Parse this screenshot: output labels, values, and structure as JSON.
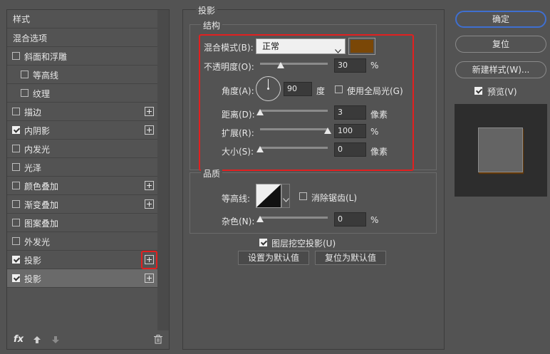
{
  "styles_list": {
    "header": "样式",
    "items": [
      {
        "label": "混合选项",
        "checkbox": false,
        "checked": false,
        "plus": false,
        "indent": 0
      },
      {
        "label": "斜面和浮雕",
        "checkbox": true,
        "checked": false,
        "plus": false,
        "indent": 0
      },
      {
        "label": "等高线",
        "checkbox": true,
        "checked": false,
        "plus": false,
        "indent": 1
      },
      {
        "label": "纹理",
        "checkbox": true,
        "checked": false,
        "plus": false,
        "indent": 1
      },
      {
        "label": "描边",
        "checkbox": true,
        "checked": false,
        "plus": true,
        "indent": 0
      },
      {
        "label": "内阴影",
        "checkbox": true,
        "checked": true,
        "plus": true,
        "indent": 0
      },
      {
        "label": "内发光",
        "checkbox": true,
        "checked": false,
        "plus": false,
        "indent": 0
      },
      {
        "label": "光泽",
        "checkbox": true,
        "checked": false,
        "plus": false,
        "indent": 0
      },
      {
        "label": "颜色叠加",
        "checkbox": true,
        "checked": false,
        "plus": true,
        "indent": 0
      },
      {
        "label": "渐变叠加",
        "checkbox": true,
        "checked": false,
        "plus": true,
        "indent": 0
      },
      {
        "label": "图案叠加",
        "checkbox": true,
        "checked": false,
        "plus": false,
        "indent": 0
      },
      {
        "label": "外发光",
        "checkbox": true,
        "checked": false,
        "plus": false,
        "indent": 0
      },
      {
        "label": "投影",
        "checkbox": true,
        "checked": true,
        "plus": true,
        "indent": 0
      },
      {
        "label": "投影",
        "checkbox": true,
        "checked": true,
        "plus": true,
        "indent": 0
      }
    ],
    "selected_index": 13,
    "highlighted_plus_index": 12,
    "bottom_icons": [
      "fx-icon",
      "move-up-icon",
      "move-down-icon",
      "trash-icon"
    ],
    "fx_label": "fx"
  },
  "buttons": {
    "ok": "确定",
    "reset": "复位",
    "new_style": "新建样式(W)...",
    "preview_label": "预览(V)",
    "preview_checked": true
  },
  "drop_shadow": {
    "title": "投影",
    "structure": {
      "title": "结构",
      "blend_mode_label": "混合模式(B):",
      "blend_mode_value": "正常",
      "shadow_color": "#7a4707",
      "opacity_label": "不透明度(O):",
      "opacity_value": "30",
      "opacity_unit": "%",
      "opacity_level": 0.3,
      "angle_label": "角度(A):",
      "angle_value": "90",
      "angle_unit": "度",
      "global_light_label": "使用全局光(G)",
      "global_light_checked": false,
      "distance_label": "距离(D):",
      "distance_value": "3",
      "distance_unit": "像素",
      "distance_level": 0.0,
      "spread_label": "扩展(R):",
      "spread_value": "100",
      "spread_unit": "%",
      "spread_level": 1.0,
      "size_label": "大小(S):",
      "size_value": "0",
      "size_unit": "像素",
      "size_level": 0.0
    },
    "quality": {
      "title": "品质",
      "contour_label": "等高线:",
      "antialias_label": "消除锯齿(L)",
      "antialias_checked": false,
      "noise_label": "杂色(N):",
      "noise_value": "0",
      "noise_unit": "%",
      "noise_level": 0.0
    },
    "knockout_label": "图层挖空投影(U)",
    "knockout_checked": true,
    "make_default": "设置为默认值",
    "reset_default": "复位为默认值"
  },
  "colors": {
    "highlight_red": "#e22020",
    "ok_border_blue": "#3f6fd0",
    "panel_bg": "#535353"
  }
}
